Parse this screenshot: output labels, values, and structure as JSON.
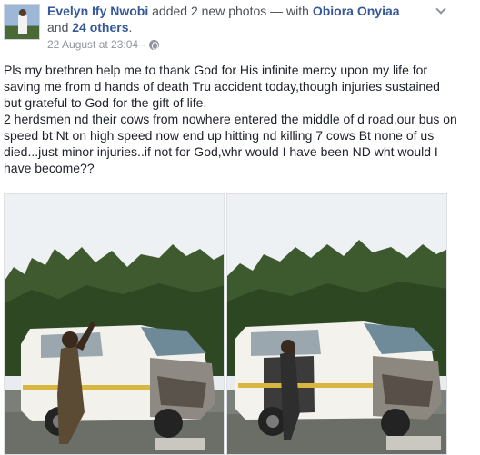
{
  "post": {
    "author": "Evelyn Ify Nwobi",
    "action_text": "added 2 new photos",
    "with_text": "— with",
    "tagged_person": "Obiora Onyiaa",
    "and_text": "and",
    "others_text": "24 others",
    "period": ".",
    "timestamp": "22 August at 23:04",
    "separator": "·",
    "privacy_icon": "globe-icon",
    "menu_icon": "chevron-down-icon",
    "paragraphs": [
      "Pls my brethren help me to thank God for His infinite mercy upon my life for saving me from d hands of death Tru accident today,though injuries sustained but grateful to God for the gift of life.",
      "2 herdsmen nd their cows from nowhere entered the middle of d road,our bus on speed bt Nt on high speed now end up hitting nd killing 7 cows Bt none of us died...just minor injuries..if not for God,whr would I have been ND wht would I have become??"
    ]
  },
  "photos": [
    {
      "name": "accident-photo-1",
      "description_icon": "photo-icon"
    },
    {
      "name": "accident-photo-2",
      "description_icon": "photo-icon"
    }
  ],
  "colors": {
    "link_blue": "#365899",
    "meta_gray": "#90949c",
    "text": "#1d2129"
  }
}
